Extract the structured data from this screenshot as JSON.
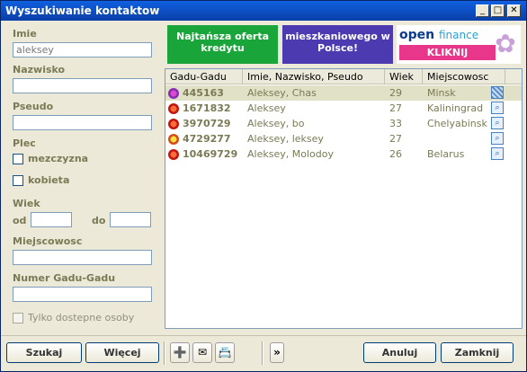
{
  "window": {
    "title": "Wyszukiwanie kontaktow",
    "controls": {
      "minimize": "_",
      "maximize": "□",
      "close": "✕"
    }
  },
  "form": {
    "first_name": {
      "label": "Imie",
      "value": "aleksey"
    },
    "last_name": {
      "label": "Nazwisko",
      "value": ""
    },
    "nickname": {
      "label": "Pseudo",
      "value": ""
    },
    "gender": {
      "label": "Plec",
      "male": "mezczyzna",
      "female": "kobieta"
    },
    "age": {
      "label": "Wiek",
      "from": "od",
      "to": "do"
    },
    "city": {
      "label": "Miejscowosc",
      "value": ""
    },
    "gg_number": {
      "label": "Numer Gadu-Gadu",
      "value": ""
    },
    "only_available": "Tylko dostepne osoby"
  },
  "banners": {
    "ad1": "Najtańsza oferta kredytu",
    "ad2": "mieszkaniowego w Polsce!",
    "ad3_brand": "open",
    "ad3_brand_suffix": "finance",
    "ad3_cta": "KLIKNIJ",
    "ad3_logo": "flower-icon"
  },
  "results": {
    "columns": [
      "Gadu-Gadu",
      "Imie, Nazwisko, Pseudo",
      "Wiek",
      "Miejscowosc"
    ],
    "rows": [
      {
        "status": "violet",
        "gg": "445163",
        "name": "Aleksey, Chas",
        "age": "29",
        "city": "Minsk",
        "selected": true
      },
      {
        "status": "red",
        "gg": "1671832",
        "name": "Aleksey",
        "age": "27",
        "city": "Kaliningrad",
        "selected": false
      },
      {
        "status": "red",
        "gg": "3970729",
        "name": "Aleksey, bo",
        "age": "33",
        "city": "Chelyabinsk",
        "selected": false
      },
      {
        "status": "yellow",
        "gg": "4729277",
        "name": "Aleksey, leksey",
        "age": "27",
        "city": "",
        "selected": false
      },
      {
        "status": "red",
        "gg": "10469729",
        "name": "Aleksey, Molodoy",
        "age": "26",
        "city": "Belarus",
        "selected": false
      }
    ]
  },
  "buttons": {
    "search": "Szukaj",
    "more": "Więcej",
    "cancel": "Anuluj",
    "close": "Zamknij",
    "expand": "»"
  }
}
